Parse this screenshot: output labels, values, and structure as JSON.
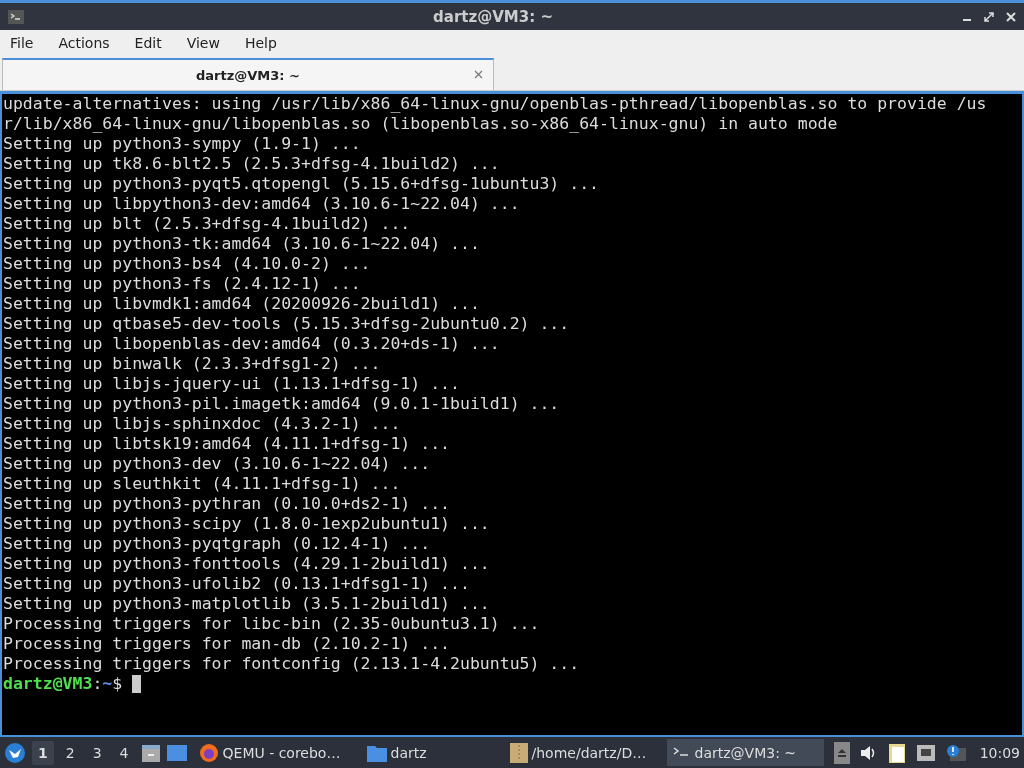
{
  "window": {
    "title": "dartz@VM3: ~"
  },
  "menu": [
    "File",
    "Actions",
    "Edit",
    "View",
    "Help"
  ],
  "tabs": [
    {
      "label": "dartz@VM3: ~",
      "selected": true
    }
  ],
  "terminal": {
    "lines": [
      "update-alternatives: using /usr/lib/x86_64-linux-gnu/openblas-pthread/libopenblas.so to provide /us",
      "r/lib/x86_64-linux-gnu/libopenblas.so (libopenblas.so-x86_64-linux-gnu) in auto mode",
      "Setting up python3-sympy (1.9-1) ...",
      "Setting up tk8.6-blt2.5 (2.5.3+dfsg-4.1build2) ...",
      "Setting up python3-pyqt5.qtopengl (5.15.6+dfsg-1ubuntu3) ...",
      "Setting up libpython3-dev:amd64 (3.10.6-1~22.04) ...",
      "Setting up blt (2.5.3+dfsg-4.1build2) ...",
      "Setting up python3-tk:amd64 (3.10.6-1~22.04) ...",
      "Setting up python3-bs4 (4.10.0-2) ...",
      "Setting up python3-fs (2.4.12-1) ...",
      "Setting up libvmdk1:amd64 (20200926-2build1) ...",
      "Setting up qtbase5-dev-tools (5.15.3+dfsg-2ubuntu0.2) ...",
      "Setting up libopenblas-dev:amd64 (0.3.20+ds-1) ...",
      "Setting up binwalk (2.3.3+dfsg1-2) ...",
      "Setting up libjs-jquery-ui (1.13.1+dfsg-1) ...",
      "Setting up python3-pil.imagetk:amd64 (9.0.1-1build1) ...",
      "Setting up libjs-sphinxdoc (4.3.2-1) ...",
      "Setting up libtsk19:amd64 (4.11.1+dfsg-1) ...",
      "Setting up python3-dev (3.10.6-1~22.04) ...",
      "Setting up sleuthkit (4.11.1+dfsg-1) ...",
      "Setting up python3-pythran (0.10.0+ds2-1) ...",
      "Setting up python3-scipy (1.8.0-1exp2ubuntu1) ...",
      "Setting up python3-pyqtgraph (0.12.4-1) ...",
      "Setting up python3-fonttools (4.29.1-2build1) ...",
      "Setting up python3-ufolib2 (0.13.1+dfsg1-1) ...",
      "Setting up python3-matplotlib (3.5.1-2build1) ...",
      "Processing triggers for libc-bin (2.35-0ubuntu3.1) ...",
      "Processing triggers for man-db (2.10.2-1) ...",
      "Processing triggers for fontconfig (2.13.1-4.2ubuntu5) ..."
    ],
    "prompt": {
      "user": "dartz@VM3",
      "separator": ":",
      "path": "~",
      "symbol": "$"
    }
  },
  "taskbar": {
    "desktops": [
      {
        "label": "1",
        "selected": true
      },
      {
        "label": "2",
        "selected": false
      },
      {
        "label": "3",
        "selected": false
      },
      {
        "label": "4",
        "selected": false
      }
    ],
    "tasks": [
      {
        "kind": "browser",
        "label": "QEMU - corebo…",
        "selected": false
      },
      {
        "kind": "folder",
        "label": "dartz",
        "selected": false
      },
      {
        "kind": "archive",
        "label": "/home/dartz/D…",
        "selected": false
      },
      {
        "kind": "terminal",
        "label": "dartz@VM3: ~",
        "selected": true
      }
    ],
    "clock": "10:09"
  }
}
